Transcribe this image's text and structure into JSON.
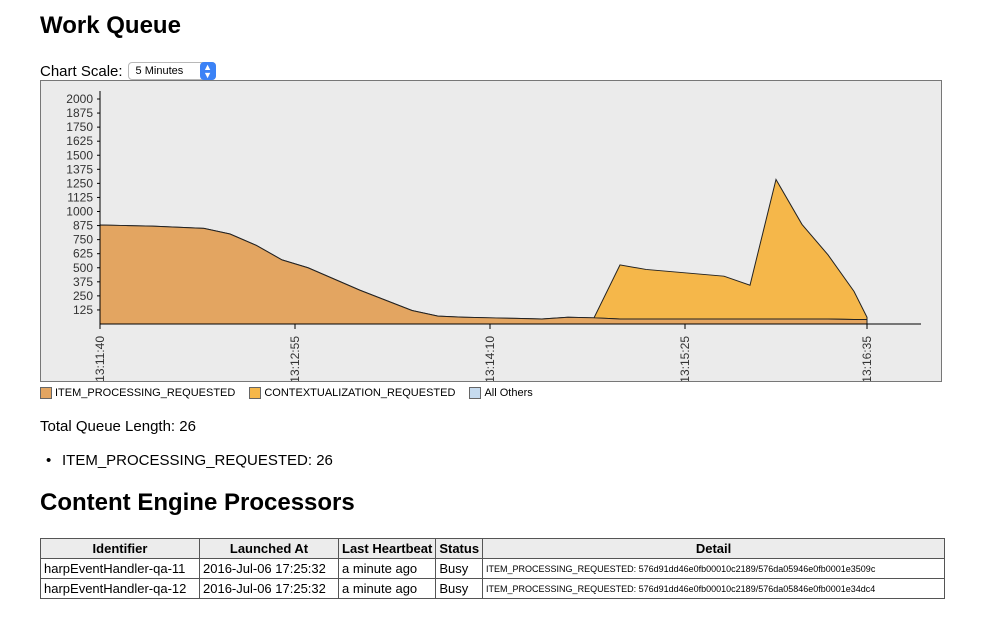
{
  "page_title": "Work Queue",
  "chart_scale": {
    "label": "Chart Scale:",
    "selected": "5 Minutes"
  },
  "chart_data": {
    "type": "area",
    "stacked": true,
    "ylim": [
      0,
      2000
    ],
    "yticks": [
      "2000",
      "1875",
      "1750",
      "1625",
      "1500",
      "1375",
      "1250",
      "1125",
      "1000",
      "875",
      "750",
      "625",
      "500",
      "375",
      "250",
      "125"
    ],
    "x": [
      "13:11:40",
      "13:11:50",
      "13:12:00",
      "13:12:10",
      "13:12:20",
      "13:12:30",
      "13:12:40",
      "13:12:50",
      "13:13:00",
      "13:13:10",
      "13:13:20",
      "13:13:30",
      "13:13:40",
      "13:13:50",
      "13:14:00",
      "13:14:10",
      "13:14:20",
      "13:14:30",
      "13:14:40",
      "13:14:50",
      "13:15:00",
      "13:15:10",
      "13:15:20",
      "13:15:30",
      "13:15:40",
      "13:15:50",
      "13:16:00",
      "13:16:10",
      "13:16:20",
      "13:16:30",
      "13:16:35"
    ],
    "xtick_labels": [
      "13:11:40",
      "13:12:55",
      "13:14:10",
      "13:15:25",
      "13:16:35"
    ],
    "series": [
      {
        "name": "ITEM_PROCESSING_REQUESTED",
        "color": "#e3a561",
        "values": [
          880,
          875,
          870,
          860,
          850,
          800,
          700,
          570,
          500,
          400,
          300,
          210,
          120,
          70,
          60,
          55,
          50,
          45,
          60,
          55,
          45,
          45,
          45,
          45,
          45,
          45,
          45,
          45,
          45,
          40,
          40
        ]
      },
      {
        "name": "CONTEXTUALIZATION_REQUESTED",
        "color": "#f5b74a",
        "values": [
          0,
          0,
          0,
          0,
          0,
          0,
          0,
          0,
          0,
          0,
          0,
          0,
          0,
          0,
          0,
          0,
          0,
          0,
          0,
          0,
          480,
          440,
          420,
          400,
          380,
          300,
          1240,
          840,
          570,
          250,
          20
        ]
      },
      {
        "name": "All Others",
        "color": "#c6dbef",
        "values": []
      }
    ],
    "grid": false
  },
  "total_queue": "Total Queue Length: 26",
  "queue_items": [
    "ITEM_PROCESSING_REQUESTED: 26"
  ],
  "processors_title": "Content Engine Processors",
  "table": {
    "headers": [
      "Identifier",
      "Launched At",
      "Last Heartbeat",
      "Status",
      "Detail"
    ],
    "rows": [
      [
        "harpEventHandler-qa-11",
        "2016-Jul-06 17:25:32",
        "a minute ago",
        "Busy",
        "ITEM_PROCESSING_REQUESTED: 576d91dd46e0fb00010c2189/576da05946e0fb0001e3509c"
      ],
      [
        "harpEventHandler-qa-12",
        "2016-Jul-06 17:25:32",
        "a minute ago",
        "Busy",
        "ITEM_PROCESSING_REQUESTED: 576d91dd46e0fb00010c2189/576da05846e0fb0001e34dc4"
      ]
    ]
  }
}
